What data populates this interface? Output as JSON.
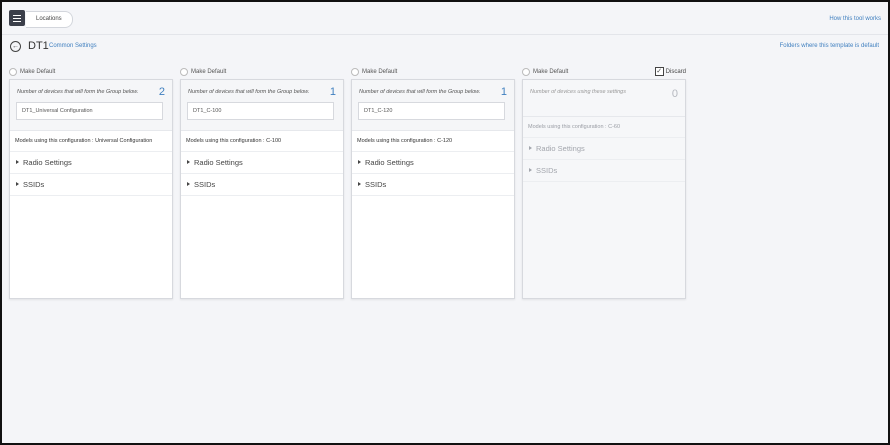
{
  "header": {
    "breadcrumb": "Locations",
    "help_link": "How this tool works"
  },
  "page": {
    "title": "DT1",
    "common_settings_link": "Common Settings",
    "folders_link": "Folders where this template is default"
  },
  "columns": [
    {
      "make_default": "Make Default",
      "description": "Number of devices that will form the Group below.",
      "count": "2",
      "name": "DT1_Universal Configuration",
      "models": "Models using this configuration : Universal Configuration",
      "sections": [
        "Radio Settings",
        "SSIDs"
      ]
    },
    {
      "make_default": "Make Default",
      "description": "Number of devices that will form the Group below.",
      "count": "1",
      "name": "DT1_C-100",
      "models": "Models using this configuration : C-100",
      "sections": [
        "Radio Settings",
        "SSIDs"
      ]
    },
    {
      "make_default": "Make Default",
      "description": "Number of devices that will form the Group below.",
      "count": "1",
      "name": "DT1_C-120",
      "models": "Models using this configuration : C-120",
      "sections": [
        "Radio Settings",
        "SSIDs"
      ]
    },
    {
      "make_default": "Make Default",
      "description": "Number of devices using these settings",
      "count": "0",
      "models": "Models using this configuration : C-60",
      "sections": [
        "Radio Settings",
        "SSIDs"
      ],
      "discard_label": "Discard",
      "discard_checked": true
    }
  ],
  "colors": {
    "accent": "#3f7fbf",
    "menu_button": "#3b3f4a",
    "background": "#f4f5f8"
  }
}
